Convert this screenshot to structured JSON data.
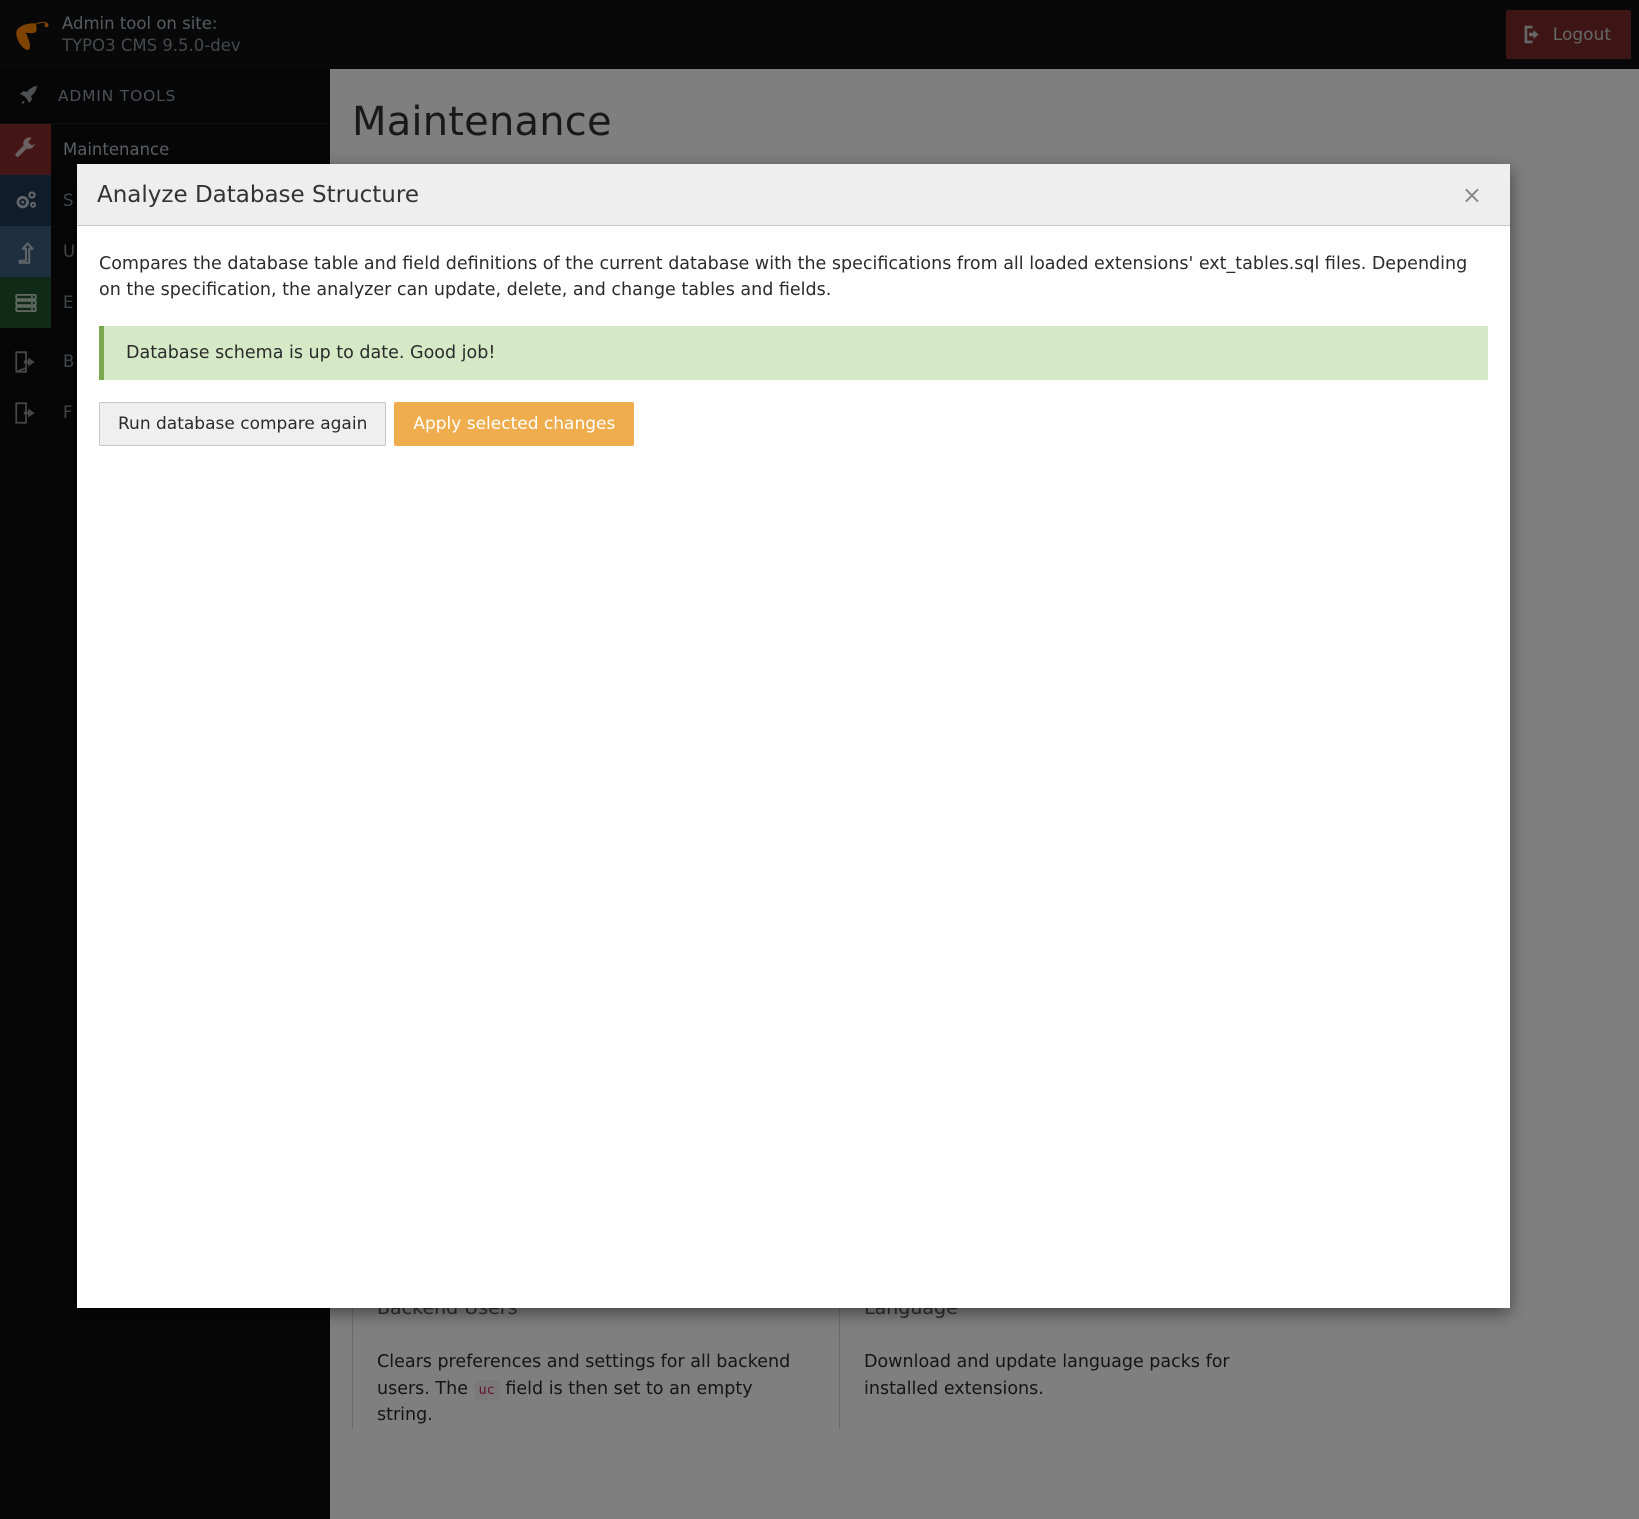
{
  "header": {
    "logo_name": "typo3-logo",
    "title_line1": "Admin tool on site:",
    "title_line2": "TYPO3 CMS 9.5.0-dev",
    "logout_label": "Logout",
    "logout_icon": "logout-arrow-icon",
    "logout_bg": "#7c2b2b"
  },
  "sidebar": {
    "heading": "ADMIN TOOLS",
    "heading_icon": "rocket-icon",
    "items": [
      {
        "label": "Maintenance",
        "icon": "wrench-icon",
        "color": "#8b2c2c",
        "active": true
      },
      {
        "label": "S",
        "icon": "gears-icon",
        "color": "#1e3a55",
        "active": false
      },
      {
        "label": "U",
        "icon": "arrow-up-turn-icon",
        "color": "#3d5f80",
        "active": false
      },
      {
        "label": "E",
        "icon": "database-icon",
        "color": "#1e5631",
        "active": false
      },
      {
        "label": "B",
        "icon": "logout-arrow-icon",
        "color": "transparent",
        "active": false
      },
      {
        "label": "F",
        "icon": "logout-arrow-icon",
        "color": "transparent",
        "active": false
      }
    ]
  },
  "main": {
    "page_title": "Maintenance",
    "cards": [
      {
        "title": "Backend Users",
        "text_before": "Clears preferences and settings for all backend users. The",
        "code": "uc",
        "text_after": "field is then set to an empty string."
      },
      {
        "title": "Language",
        "text_before": "Download and update language packs for installed extensions.",
        "code": "",
        "text_after": ""
      }
    ]
  },
  "modal": {
    "title": "Analyze Database Structure",
    "close_icon": "close-icon",
    "close_label": "×",
    "paragraph": "Compares the database table and field definitions of the current database with the specifications from all loaded extensions' ext_tables.sql files. Depending on the specification, the analyzer can update, delete, and change tables and fields.",
    "alert": {
      "text": "Database schema is up to date. Good job!",
      "bg": "#d6e9c6",
      "accent": "#7aa84f"
    },
    "buttons": {
      "run_compare": "Run database compare again",
      "apply_changes": "Apply selected changes",
      "apply_changes_bg": "#f0ad4e"
    }
  }
}
